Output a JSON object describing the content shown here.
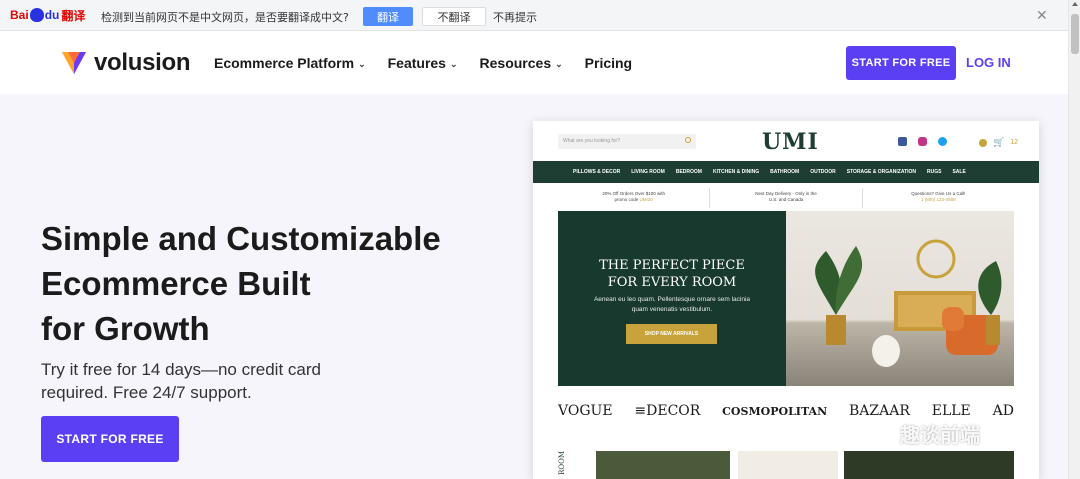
{
  "transbar": {
    "logo_bai": "Bai",
    "logo_du": "du",
    "logo_fanyi": "翻译",
    "message": "检测到当前网页不是中文网页，是否要翻译成中文?",
    "translate_label": "翻译",
    "no_translate_label": "不翻译",
    "never_label": "不再提示",
    "close": "✕"
  },
  "header": {
    "logo_text": "volusion",
    "nav": [
      {
        "label": "Ecommerce Platform",
        "chevron": "⌄"
      },
      {
        "label": "Features",
        "chevron": "⌄"
      },
      {
        "label": "Resources",
        "chevron": "⌄"
      },
      {
        "label": "Pricing",
        "chevron": ""
      }
    ],
    "start_label": "START FOR FREE",
    "login_label": "LOG IN"
  },
  "hero": {
    "title_line1": "Simple and Customizable",
    "title_line2": "Ecommerce Built",
    "title_line3": "for Growth",
    "subtitle": "Try it free for 14 days—no credit card required. Free 24/7 support.",
    "start_label": "START FOR FREE"
  },
  "preview": {
    "search_placeholder": "What are you looking for?",
    "brand": "UMI",
    "cart_count": "12",
    "nav": [
      "PILLOWS & DECOR",
      "LIVING ROOM",
      "BEDROOM",
      "KITCHEN & DINING",
      "BATHROOM",
      "OUTDOOR",
      "STORAGE & ORGANIZATION",
      "RUGS",
      "SALE"
    ],
    "promo1": "20% Off Orders Over $100 with",
    "promo1b": "promo code",
    "promo1code": "UMI20",
    "promo2": "Next Day Delivery - Only in the",
    "promo2b": "U.S. and Canada",
    "promo3": "Questions? Give Us a Call!",
    "promo3b": "1 (800) 123-4568",
    "hero_title1": "THE PERFECT PIECE",
    "hero_title2": "FOR EVERY ROOM",
    "hero_desc": "Aenean eu leo quam. Pellentesque ornare sem lacinia quam venenatis vestibulum.",
    "hero_button": "SHOP NEW ARRIVALS",
    "logos": [
      "VOGUE",
      "≡DECOR",
      "COSMOPOLITAN",
      "BAZAAR",
      "ELLE",
      "AD"
    ],
    "side_text": "ROOM"
  },
  "watermark": "趣谈前端",
  "colors": {
    "brand": "#5b3ff5",
    "store_green": "#1e3d33",
    "gold": "#c8a23a"
  }
}
